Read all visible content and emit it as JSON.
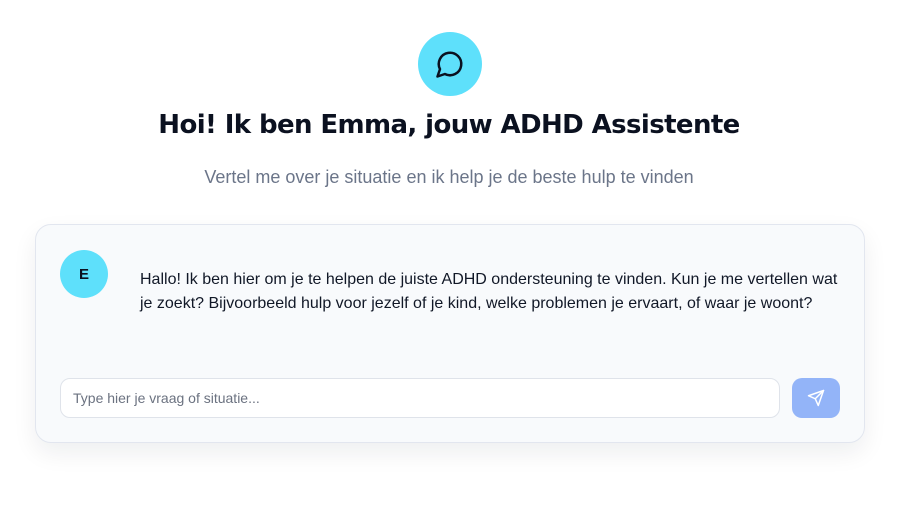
{
  "header": {
    "icon": "message-circle-icon",
    "title": "Hoi! Ik ben Emma, jouw ADHD Assistente",
    "subtitle": "Vertel me over je situatie en ik help je de beste hulp te vinden"
  },
  "chat": {
    "messages": [
      {
        "sender_initial": "E",
        "text": "Hallo! Ik ben hier om je te helpen de juiste ADHD ondersteuning te vinden. Kun je me vertellen wat je zoekt? Bijvoorbeeld hulp voor jezelf of je kind, welke problemen je ervaart, of waar je woont?"
      }
    ],
    "input": {
      "value": "",
      "placeholder": "Type hier je vraag of situatie..."
    },
    "send_icon": "send-icon"
  },
  "colors": {
    "accent_cyan": "#5ee0fb",
    "send_button": "#93b4f8",
    "title_text": "#0b1120",
    "subtitle_text": "#6b7589",
    "card_background": "#f8fafc"
  }
}
